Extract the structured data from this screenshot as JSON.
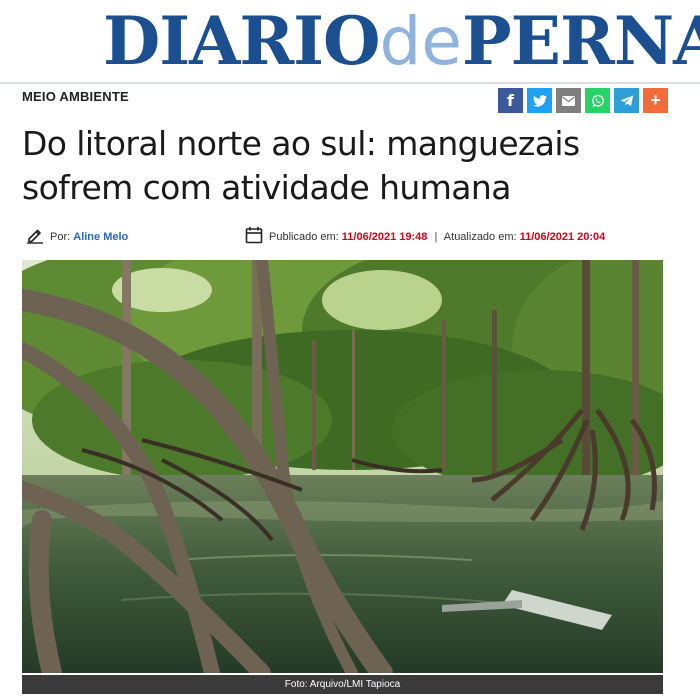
{
  "masthead": {
    "logo_part1": "DIARIO",
    "logo_part2": "de",
    "logo_part3": "PERNAMBUCO",
    "brand_color": "#1b4f90",
    "accent_color": "#8fb3dc"
  },
  "section": "MEIO AMBIENTE",
  "share": {
    "buttons": [
      {
        "icon": "facebook-icon",
        "glyph": "f",
        "color": "#3b5998"
      },
      {
        "icon": "twitter-icon",
        "glyph": "",
        "color": "#1da1f2"
      },
      {
        "icon": "email-icon",
        "glyph": "",
        "color": "#7f7f7f"
      },
      {
        "icon": "whatsapp-icon",
        "glyph": "",
        "color": "#25d366"
      },
      {
        "icon": "telegram-icon",
        "glyph": "",
        "color": "#2e9ed8"
      },
      {
        "icon": "plus-icon",
        "glyph": "+",
        "color": "#f26b3a"
      }
    ]
  },
  "article": {
    "headline": "Do litoral norte ao sul: manguezais sofrem com atividade humana",
    "author_prefix": "Por:",
    "author": "Aline Melo",
    "published_label": "Publicado em:",
    "published": "11/06/2021 19:48",
    "separator": "|",
    "updated_label": "Atualizado em:",
    "updated": "11/06/2021 20:04",
    "photo_caption": "Foto: Arquivo/LMI Tapioca"
  }
}
